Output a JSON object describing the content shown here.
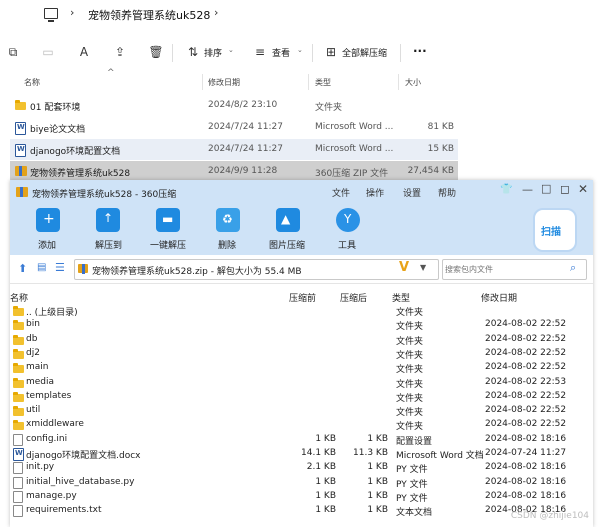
{
  "explorer": {
    "breadcrumb": "宠物领养管理系统uk528",
    "toolbar": {
      "sort_label": "排序",
      "view_label": "查看",
      "extract_all_label": "全部解压缩",
      "more_label": "···"
    },
    "columns": [
      "名称",
      "修改日期",
      "类型",
      "大小"
    ],
    "rows": [
      {
        "name": "01 配套环境",
        "date": "2024/8/2 23:10",
        "type": "文件夹",
        "size": "",
        "icon": "folder-icon"
      },
      {
        "name": "biye论文文档",
        "date": "2024/7/24 11:27",
        "type": "Microsoft Word ...",
        "size": "81 KB",
        "icon": "word-icon"
      },
      {
        "name": "djanogo环境配置文档",
        "date": "2024/7/24 11:27",
        "type": "Microsoft Word ...",
        "size": "15 KB",
        "icon": "word-icon"
      },
      {
        "name": "宠物领养管理系统uk528",
        "date": "2024/9/9 11:28",
        "type": "360压缩 ZIP 文件",
        "size": "27,454 KB",
        "icon": "zip-icon"
      }
    ]
  },
  "zip": {
    "title": "宠物领养管理系统uk528 - 360压缩",
    "menu": [
      "文件",
      "操作",
      "设置",
      "帮助"
    ],
    "tools": [
      "添加",
      "解压到",
      "一键解压",
      "删除",
      "图片压缩",
      "工具"
    ],
    "badge": "扫描",
    "path": "宠物领养管理系统uk528.zip - 解包大小为 55.4 MB",
    "search_placeholder": "搜索包内文件",
    "columns": [
      "名称",
      "压缩前",
      "压缩后",
      "类型",
      "修改日期"
    ],
    "rows": [
      {
        "name": ".. (上级目录)",
        "before": "",
        "after": "",
        "type": "文件夹",
        "date": "",
        "icon": "folder-icon"
      },
      {
        "name": "bin",
        "before": "",
        "after": "",
        "type": "文件夹",
        "date": "2024-08-02 22:52",
        "icon": "folder-icon"
      },
      {
        "name": "db",
        "before": "",
        "after": "",
        "type": "文件夹",
        "date": "2024-08-02 22:52",
        "icon": "folder-icon"
      },
      {
        "name": "dj2",
        "before": "",
        "after": "",
        "type": "文件夹",
        "date": "2024-08-02 22:52",
        "icon": "folder-icon"
      },
      {
        "name": "main",
        "before": "",
        "after": "",
        "type": "文件夹",
        "date": "2024-08-02 22:52",
        "icon": "folder-icon"
      },
      {
        "name": "media",
        "before": "",
        "after": "",
        "type": "文件夹",
        "date": "2024-08-02 22:53",
        "icon": "folder-icon"
      },
      {
        "name": "templates",
        "before": "",
        "after": "",
        "type": "文件夹",
        "date": "2024-08-02 22:52",
        "icon": "folder-icon"
      },
      {
        "name": "util",
        "before": "",
        "after": "",
        "type": "文件夹",
        "date": "2024-08-02 22:52",
        "icon": "folder-icon"
      },
      {
        "name": "xmiddleware",
        "before": "",
        "after": "",
        "type": "文件夹",
        "date": "2024-08-02 22:52",
        "icon": "folder-icon"
      },
      {
        "name": "config.ini",
        "before": "1 KB",
        "after": "1 KB",
        "type": "配置设置",
        "date": "2024-08-02 18:16",
        "icon": "file-icon"
      },
      {
        "name": "djanogo环境配置文档.docx",
        "before": "14.1 KB",
        "after": "11.3 KB",
        "type": "Microsoft Word 文档",
        "date": "2024-07-24 11:27",
        "icon": "word-icon"
      },
      {
        "name": "init.py",
        "before": "2.1 KB",
        "after": "1 KB",
        "type": "PY 文件",
        "date": "2024-08-02 18:16",
        "icon": "file-icon"
      },
      {
        "name": "initial_hive_database.py",
        "before": "1 KB",
        "after": "1 KB",
        "type": "PY 文件",
        "date": "2024-08-02 18:16",
        "icon": "file-icon"
      },
      {
        "name": "manage.py",
        "before": "1 KB",
        "after": "1 KB",
        "type": "PY 文件",
        "date": "2024-08-02 18:16",
        "icon": "file-icon"
      },
      {
        "name": "requirements.txt",
        "before": "1 KB",
        "after": "1 KB",
        "type": "文本文档",
        "date": "2024-08-02 18:16",
        "icon": "file-icon"
      }
    ],
    "watermark": "CSDN @zhijie104"
  }
}
